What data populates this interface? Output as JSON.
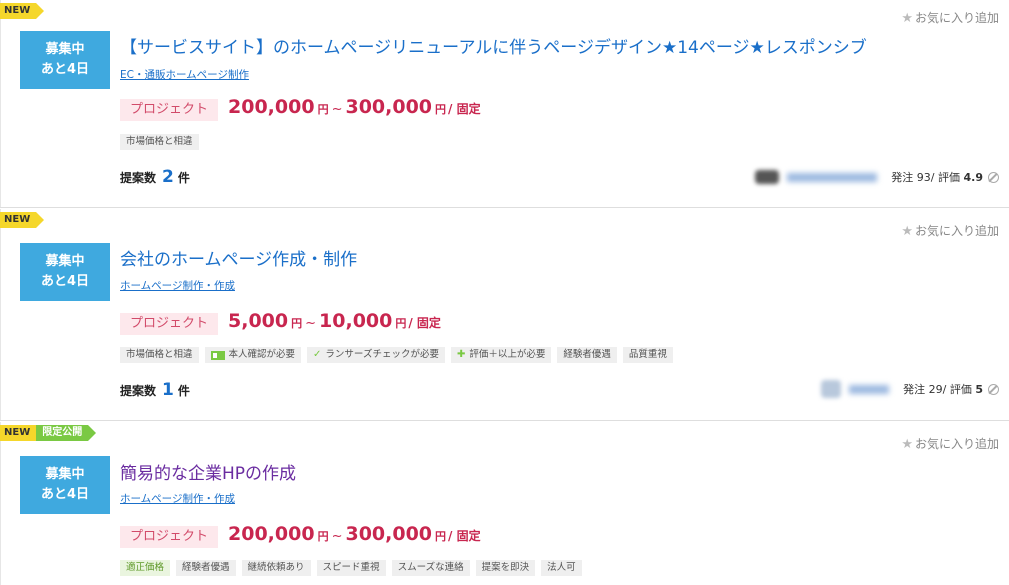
{
  "jobs": [
    {
      "badge_new": "NEW",
      "badge_limited": "",
      "status_line1": "募集中",
      "status_line2": "あと4日",
      "fav_label": "お気に入り追加",
      "title": "【サービスサイト】のホームページリニューアルに伴うページデザイン★14ページ★レスポンシブ",
      "category": "EC・通販ホームページ制作",
      "type": "プロジェクト",
      "price_low": "200,000",
      "price_high": "300,000",
      "yen": "円",
      "tilde": "~",
      "price_type": "/ 固定",
      "tags": [
        "市場価格と相違"
      ],
      "proposals_label": "提案数",
      "proposals_count": "2",
      "proposals_unit": "件",
      "client_orders": "発注 93/",
      "client_rating_label": "評価",
      "client_rating": "4.9"
    },
    {
      "badge_new": "NEW",
      "badge_limited": "",
      "status_line1": "募集中",
      "status_line2": "あと4日",
      "fav_label": "お気に入り追加",
      "title": "会社のホームページ作成・制作",
      "category": "ホームページ制作・作成",
      "type": "プロジェクト",
      "price_low": "5,000",
      "price_high": "10,000",
      "yen": "円",
      "tilde": "~",
      "price_type": "/ 固定",
      "tags": [
        "市場価格と相違",
        "本人確認が必要",
        "ランサーズチェックが必要",
        "評価＋以上が必要",
        "経験者優遇",
        "品質重視"
      ],
      "proposals_label": "提案数",
      "proposals_count": "1",
      "proposals_unit": "件",
      "client_orders": "発注 29/",
      "client_rating_label": "評価",
      "client_rating": "5"
    },
    {
      "badge_new": "NEW",
      "badge_limited": "限定公開",
      "status_line1": "募集中",
      "status_line2": "あと4日",
      "fav_label": "お気に入り追加",
      "title": "簡易的な企業HPの作成",
      "category": "ホームページ制作・作成",
      "type": "プロジェクト",
      "price_low": "200,000",
      "price_high": "300,000",
      "yen": "円",
      "tilde": "~",
      "price_type": "/ 固定",
      "tags": [
        "適正価格",
        "経験者優遇",
        "継続依頼あり",
        "スピード重視",
        "スムーズな連絡",
        "提案を即決",
        "法人可"
      ]
    }
  ],
  "colors": {
    "status_bg": "#3fa9df",
    "price": "#c8264f",
    "link": "#1a6fc9",
    "new_badge": "#f5d72b",
    "limited_badge": "#7ac943"
  }
}
